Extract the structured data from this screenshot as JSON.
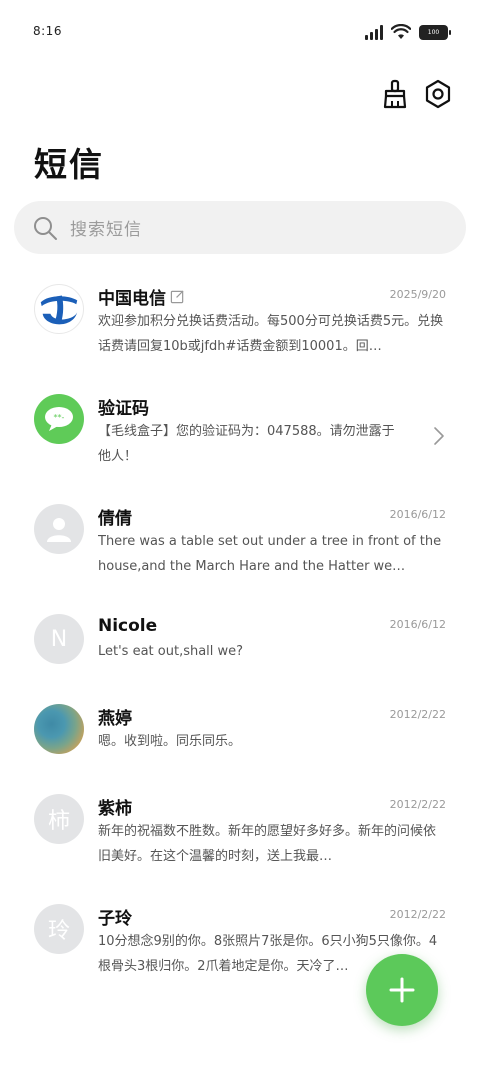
{
  "status_bar": {
    "time": "8:16",
    "battery": "100"
  },
  "toolbar": {
    "clean_icon": "broom-icon",
    "settings_icon": "hexagon-gear-icon"
  },
  "header": {
    "title": "短信"
  },
  "search": {
    "placeholder": "搜索短信"
  },
  "conversations": [
    {
      "name": "中国电信",
      "date": "2025/9/20",
      "preview": "欢迎参加积分兑换话费活动。每500分可兑换话费5元。兑换话费请回复10b或jfdh#话费金额到10001。回…",
      "avatar": "china-telecom-logo",
      "badge_icon": "edit-icon"
    },
    {
      "name": "验证码",
      "date": "",
      "preview": "【毛线盒子】您的验证码为：047588。请勿泄露于他人！",
      "avatar": "message-bubble-icon",
      "trailing_icon": "chevron-right-icon"
    },
    {
      "name": "倩倩",
      "date": "2016/6/12",
      "preview": "There was a table set out under a tree in front of the house,and the March Hare and the Hatter we…",
      "avatar": "person-icon"
    },
    {
      "name": "Nicole",
      "date": "2016/6/12",
      "preview": "Let's eat out,shall we?",
      "avatar": "N"
    },
    {
      "name": "燕婷",
      "date": "2012/2/22",
      "preview": "嗯。收到啦。同乐同乐。",
      "avatar": "photo"
    },
    {
      "name": "紫柿",
      "date": "2012/2/22",
      "preview": "新年的祝福数不胜数。新年的愿望好多好多。新年的问候依旧美好。在这个温馨的时刻，送上我最…",
      "avatar": "柿"
    },
    {
      "name": "子玲",
      "date": "2012/2/22",
      "preview": "10分想念9别的你。8张照片7张是你。6只小狗5只像你。4根骨头3根归你。2爪着地定是你。天冷了…",
      "avatar": "玲"
    }
  ],
  "fab": {
    "icon": "plus-icon"
  },
  "colors": {
    "accent_green": "#5cc95a",
    "search_bg": "#f1f1f1",
    "avatar_gray": "#e3e4e6",
    "telecom_blue": "#1b5fb8"
  }
}
